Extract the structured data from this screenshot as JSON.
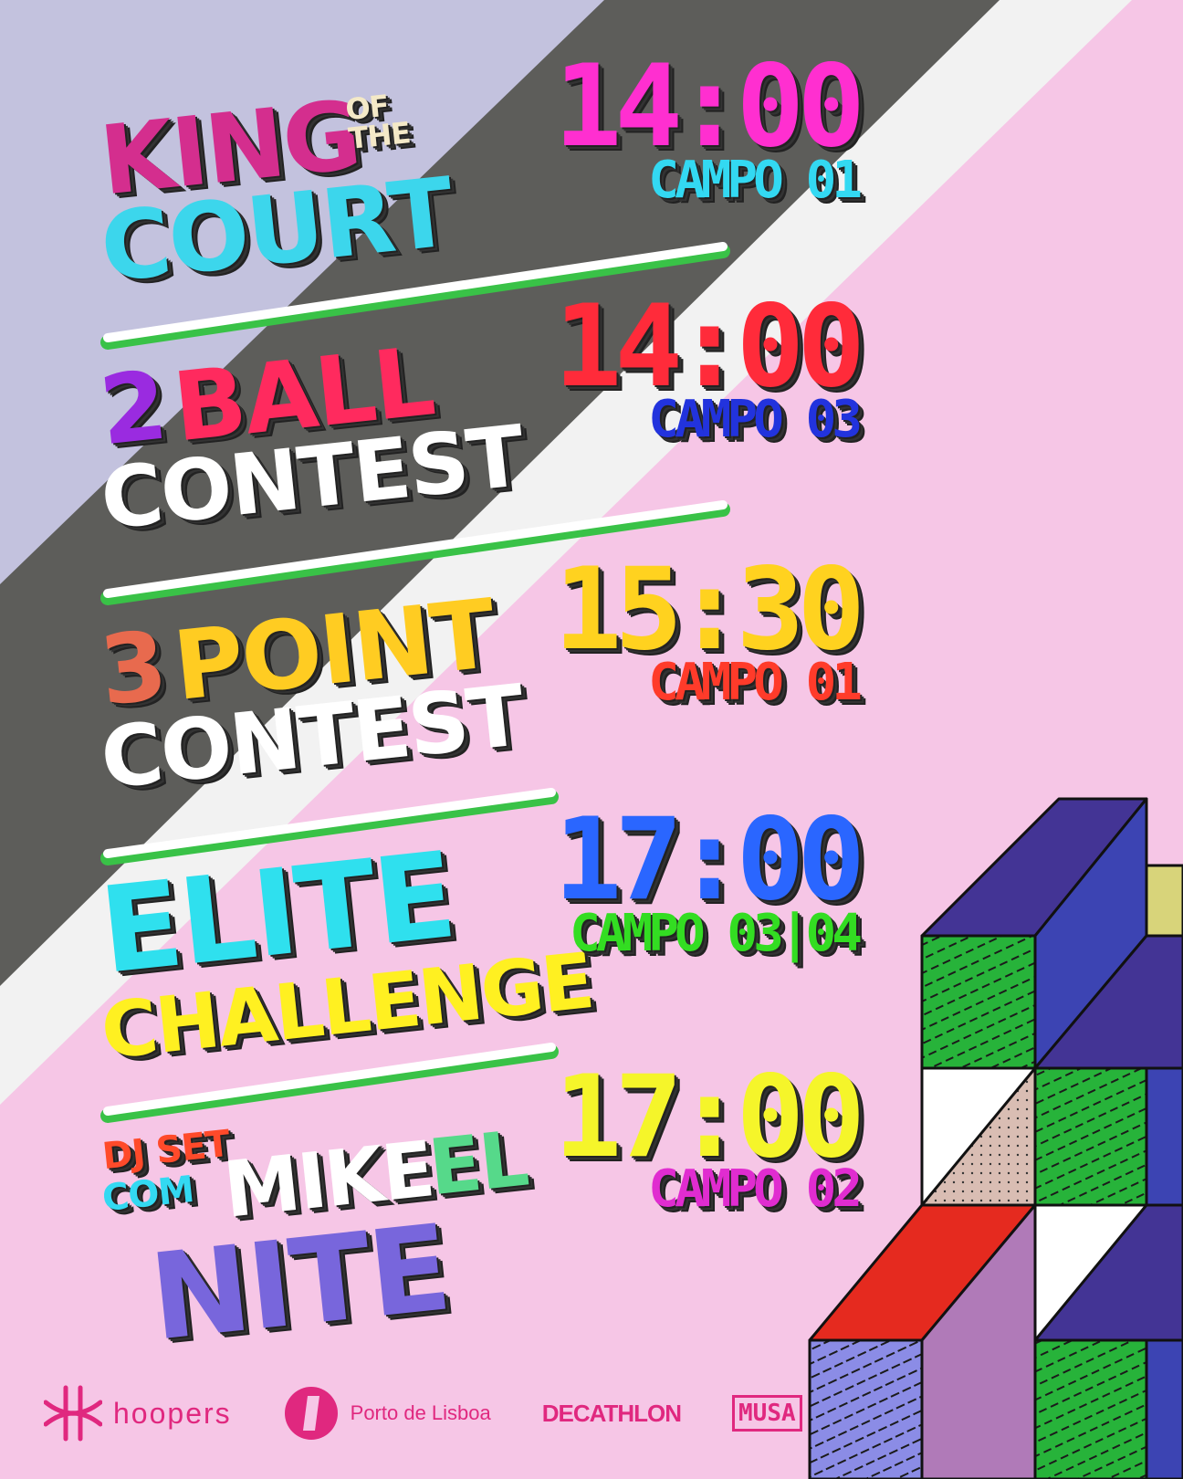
{
  "colors": {
    "lavender": "#c3c2de",
    "charcoal": "#5d5d5a",
    "white": "#f2f2f2",
    "pink": "#f6c6e6",
    "magenta": "#e02c8c"
  },
  "events": [
    {
      "title_line1": "KING",
      "title_small": "OF THE",
      "title_line2": "COURT",
      "time": "14:00",
      "campo": "CAMPO 01",
      "time_color": "#ff2fd0",
      "campo_color": "#33d9f2"
    },
    {
      "title_prefix": "2",
      "title_line1": "BALL",
      "title_line2": "CONTEST",
      "time": "14:00",
      "campo": "CAMPO 03",
      "time_color": "#ff2b3a",
      "campo_color": "#2233dd"
    },
    {
      "title_prefix": "3",
      "title_line1": "POINT",
      "title_line2": "CONTEST",
      "time": "15:30",
      "campo": "CAMPO 01",
      "time_color": "#ffd21f",
      "campo_color": "#ff3b2a"
    },
    {
      "title_line1": "ELITE",
      "title_line2": "CHALLENGE",
      "time": "17:00",
      "campo": "CAMPO 03|04",
      "time_color": "#2a66ff",
      "campo_color": "#33dd22"
    },
    {
      "title_small1": "DJ SET",
      "title_small2": "COM",
      "title_line1a": "MIKE",
      "title_line1b": "EL",
      "title_line2": "NITE",
      "time": "17:00",
      "campo": "CAMPO 02",
      "time_color": "#f5f52a",
      "campo_color": "#e02cd0"
    }
  ],
  "sponsors": {
    "hoopers": "hoopers",
    "porto": "Porto de Lisboa",
    "decathlon": "DECATHLON",
    "musa": "MUSA"
  }
}
